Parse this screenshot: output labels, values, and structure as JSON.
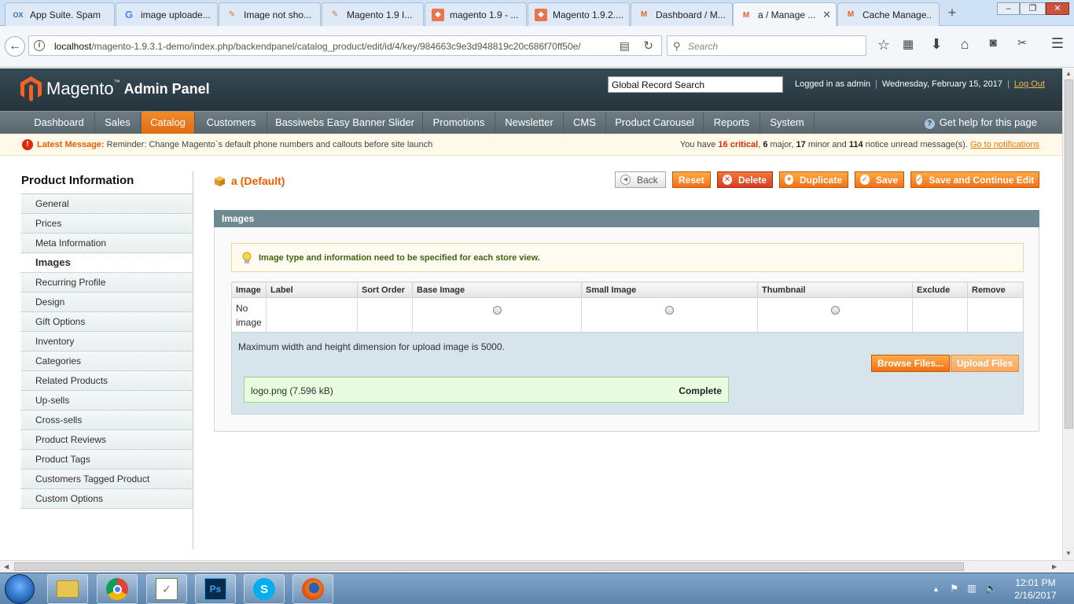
{
  "browser": {
    "tabs": [
      {
        "label": "App Suite. Spam",
        "icon": "ox-icon"
      },
      {
        "label": "image uploade...",
        "icon": "google-icon"
      },
      {
        "label": "Image not sho...",
        "icon": "stackexchange-icon"
      },
      {
        "label": "Magento 1.9 I...",
        "icon": "stackexchange-icon"
      },
      {
        "label": "magento 1.9 - ...",
        "icon": "magento-se-icon"
      },
      {
        "label": "Magento 1.9.2....",
        "icon": "magento-se-icon"
      },
      {
        "label": "Dashboard / M...",
        "icon": "magento-icon"
      },
      {
        "label": "a / Manage ...",
        "icon": "magento-icon",
        "active": true
      },
      {
        "label": "Cache Manage...",
        "icon": "magento-icon"
      }
    ],
    "url_host": "localhost",
    "url_path": "/magento-1.9.3.1-demo/index.php/backendpanel/catalog_product/edit/id/4/key/984663c9e3d948819c20c686f70ff50e/",
    "search_placeholder": "Search"
  },
  "header": {
    "brand": "Magento",
    "brand_tm": "™",
    "subtitle": "Admin Panel",
    "global_search": "Global Record Search",
    "logged_in": "Logged in as admin",
    "date": "Wednesday, February 15, 2017",
    "logout": "Log Out"
  },
  "nav": {
    "items": [
      "Dashboard",
      "Sales",
      "Catalog",
      "Customers",
      "Bassiwebs Easy Banner Slider",
      "Promotions",
      "Newsletter",
      "CMS",
      "Product Carousel",
      "Reports",
      "System"
    ],
    "active": "Catalog",
    "help": "Get help for this page"
  },
  "message": {
    "label": "Latest Message:",
    "text": "Reminder: Change Magento`s default phone numbers and callouts before site launch",
    "prefix": "You have",
    "critical_count": "16",
    "critical_word": "critical",
    "major_count": "6",
    "major_word": "major,",
    "minor_count": "17",
    "minor_word": "minor and",
    "notice_count": "114",
    "notice_word": "notice unread message(s).",
    "link": "Go to notifications"
  },
  "sidebar": {
    "title": "Product Information",
    "items": [
      "General",
      "Prices",
      "Meta Information",
      "Images",
      "Recurring Profile",
      "Design",
      "Gift Options",
      "Inventory",
      "Categories",
      "Related Products",
      "Up-sells",
      "Cross-sells",
      "Product Reviews",
      "Product Tags",
      "Customers Tagged Product",
      "Custom Options"
    ],
    "active": "Images"
  },
  "page": {
    "title": "a (Default)",
    "buttons": {
      "back": "Back",
      "reset": "Reset",
      "delete": "Delete",
      "duplicate": "Duplicate",
      "save": "Save",
      "save_continue": "Save and Continue Edit"
    }
  },
  "images_section": {
    "title": "Images",
    "notice": "Image type and information need to be specified for each store view.",
    "columns": [
      "Image",
      "Label",
      "Sort Order",
      "Base Image",
      "Small Image",
      "Thumbnail",
      "Exclude",
      "Remove"
    ],
    "row_image_text": "No image",
    "max_dimension": "Maximum width and height dimension for upload image is 5000.",
    "browse_label": "Browse Files...",
    "upload_label": "Upload Files",
    "file_name": "logo.png (7.596 kB)",
    "file_status": "Complete"
  },
  "taskbar": {
    "apps": [
      "file-explorer-icon",
      "chrome-icon",
      "task-app-icon",
      "photoshop-icon",
      "skype-icon",
      "firefox-icon"
    ],
    "time": "12:01 PM",
    "date": "2/16/2017"
  },
  "colors": {
    "accent_orange": "#eb5e00",
    "header_dark": "#26343b",
    "nav_gray": "#616f77",
    "section_head": "#6f8992"
  }
}
